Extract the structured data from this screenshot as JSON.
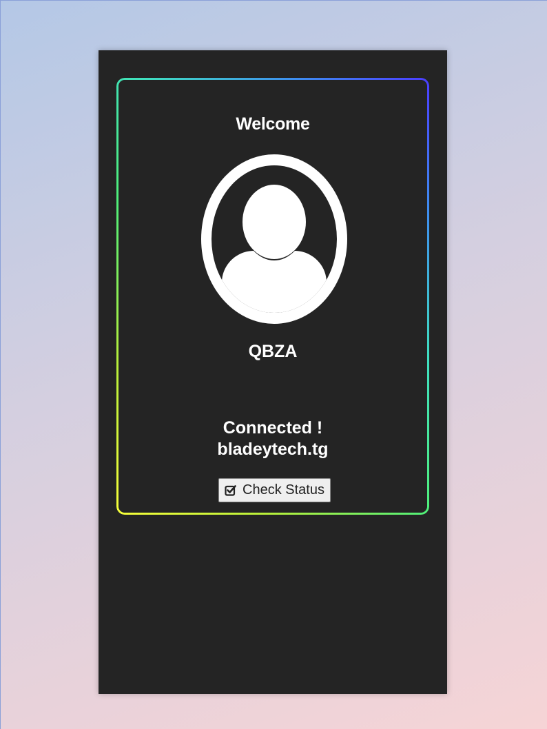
{
  "card": {
    "heading": "Welcome",
    "username": "QBZA",
    "status_line1": "Connected !",
    "status_line2": "bladeytech.tg"
  },
  "button": {
    "icon": "check-square-icon",
    "label": "Check Status"
  },
  "icons": {
    "avatar": "user-avatar-icon"
  },
  "colors": {
    "panel_background": "#242424",
    "text": "#ffffff",
    "glow_top_right": "#4b3cff",
    "glow_middle": "#4ff07a",
    "glow_bottom_left": "#f7ff3a"
  }
}
